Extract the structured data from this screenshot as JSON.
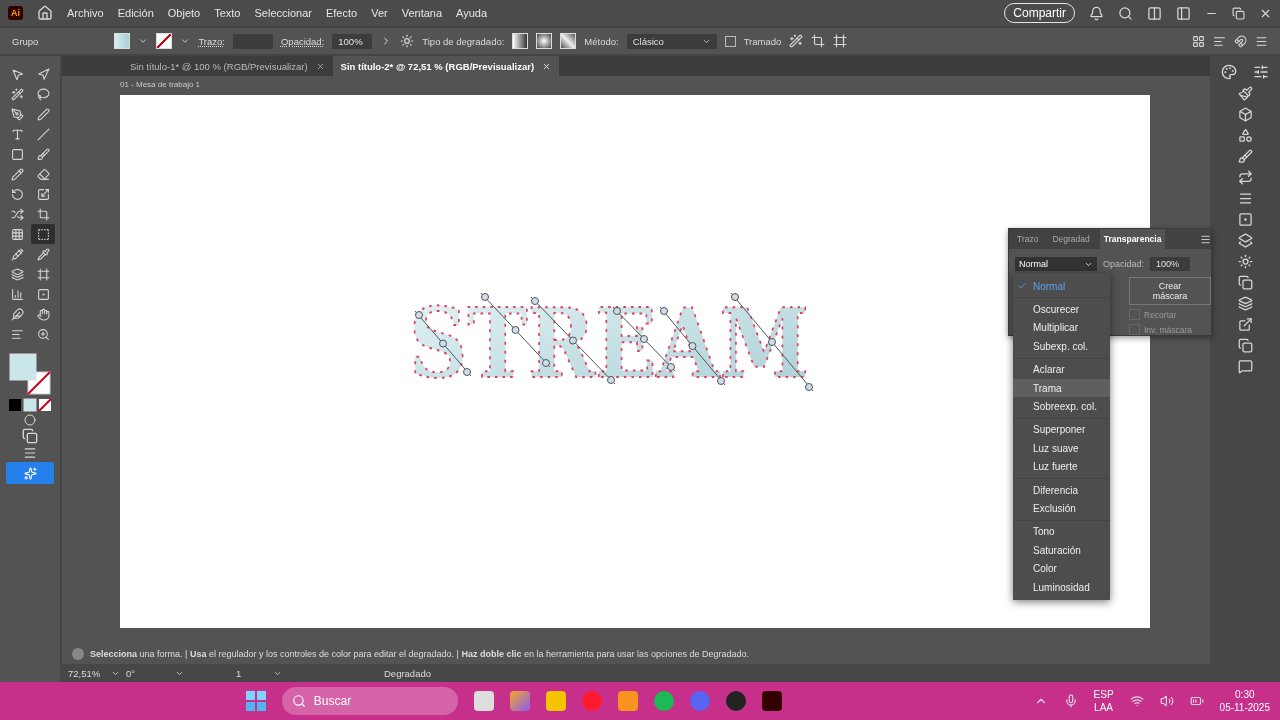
{
  "menu_bar": {
    "app_badge": "Ai",
    "items": [
      "Archivo",
      "Edición",
      "Objeto",
      "Texto",
      "Seleccionar",
      "Efecto",
      "Ver",
      "Ventana",
      "Ayuda"
    ],
    "share_button": "Compartir"
  },
  "control_bar": {
    "selection": "Grupo",
    "stroke_label": "Trazo:",
    "opacity_label": "Opacidad:",
    "opacity_value": "100%",
    "gradient_type_label": "Tipo de degradado:",
    "method_label": "Método:",
    "method_value": "Clásico",
    "dither": {
      "label": "Tramado",
      "checked": false
    }
  },
  "document_tabs": [
    {
      "label": "Sin título-1* @ 100 % (RGB/Previsualizar)",
      "selected": false
    },
    {
      "label": "Sin título-2* @ 72,51 % (RGB/Previsualizar)",
      "selected": true
    }
  ],
  "artboard": {
    "label": "01 - Mesa de trabajo 1",
    "artwork_text": "STREAM"
  },
  "tools": [
    {
      "selected": false
    },
    {
      "selected": false
    },
    {
      "selected": false
    },
    {
      "selected": false
    },
    {
      "selected": false
    },
    {
      "selected": false
    },
    {
      "selected": false
    },
    {
      "selected": false
    },
    {
      "selected": false
    },
    {
      "selected": false
    },
    {
      "selected": false
    },
    {
      "selected": false
    },
    {
      "selected": false
    },
    {
      "selected": false
    },
    {
      "selected": false
    },
    {
      "selected": false
    },
    {
      "selected": false
    },
    {
      "selected": true
    },
    {
      "selected": false
    },
    {
      "selected": false
    },
    {
      "selected": false
    },
    {
      "selected": false
    },
    {
      "selected": false
    },
    {
      "selected": false
    },
    {
      "selected": false
    },
    {
      "selected": false
    },
    {
      "selected": false
    },
    {
      "selected": false
    }
  ],
  "transparency_panel": {
    "tabs": [
      {
        "label": "Trazo",
        "selected": false
      },
      {
        "label": "Degradad",
        "selected": false
      },
      {
        "label": "Transparencia",
        "selected": true
      }
    ],
    "blend_mode": "Normal",
    "opacity_label": "Opacidad:",
    "opacity_value": "100%",
    "mask_button": "Crear máscara",
    "options": [
      {
        "label": "Recortar",
        "checked": false,
        "disabled": true
      },
      {
        "label": "Inv. máscara",
        "checked": false,
        "disabled": true
      }
    ]
  },
  "blend_menu": [
    [
      {
        "label": "Normal",
        "selected": true,
        "hovered": false
      }
    ],
    [
      {
        "label": "Oscurecer",
        "selected": false,
        "hovered": false
      },
      {
        "label": "Multiplicar",
        "selected": false,
        "hovered": false
      },
      {
        "label": "Subexp. col.",
        "selected": false,
        "hovered": false
      }
    ],
    [
      {
        "label": "Aclarar",
        "selected": false,
        "hovered": false
      },
      {
        "label": "Trama",
        "selected": false,
        "hovered": true
      },
      {
        "label": "Sobreexp. col.",
        "selected": false,
        "hovered": false
      }
    ],
    [
      {
        "label": "Superponer",
        "selected": false,
        "hovered": false
      },
      {
        "label": "Luz suave",
        "selected": false,
        "hovered": false
      },
      {
        "label": "Luz fuerte",
        "selected": false,
        "hovered": false
      }
    ],
    [
      {
        "label": "Diferencia",
        "selected": false,
        "hovered": false
      },
      {
        "label": "Exclusión",
        "selected": false,
        "hovered": false
      }
    ],
    [
      {
        "label": "Tono",
        "selected": false,
        "hovered": false
      },
      {
        "label": "Saturación",
        "selected": false,
        "hovered": false
      },
      {
        "label": "Color",
        "selected": false,
        "hovered": false
      },
      {
        "label": "Luminosidad",
        "selected": false,
        "hovered": false
      }
    ]
  ],
  "status_bar": {
    "message": "**Selecciona** una forma.  |  **Usa** el regulador y los controles de color para editar el degradado.  |  **Haz doble clic** en la herramienta para usar las opciones de Degradado.",
    "zoom": "72,51%",
    "rotation": "0°",
    "artboard_number": "1",
    "current_tool": "Degradado"
  },
  "taskbar": {
    "search_placeholder": "Buscar",
    "language": "ESP",
    "layout": "LAA",
    "time": "0:30",
    "date": "05-11-2025"
  }
}
